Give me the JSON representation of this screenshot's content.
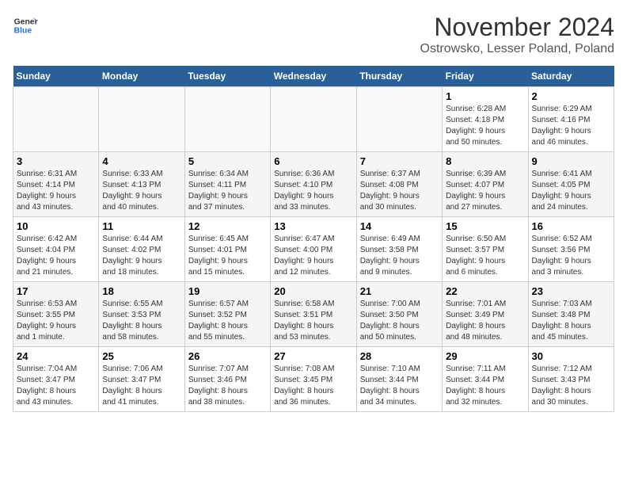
{
  "header": {
    "logo_line1": "General",
    "logo_line2": "Blue",
    "month_title": "November 2024",
    "subtitle": "Ostrowsko, Lesser Poland, Poland"
  },
  "weekdays": [
    "Sunday",
    "Monday",
    "Tuesday",
    "Wednesday",
    "Thursday",
    "Friday",
    "Saturday"
  ],
  "weeks": [
    [
      {
        "day": "",
        "info": ""
      },
      {
        "day": "",
        "info": ""
      },
      {
        "day": "",
        "info": ""
      },
      {
        "day": "",
        "info": ""
      },
      {
        "day": "",
        "info": ""
      },
      {
        "day": "1",
        "info": "Sunrise: 6:28 AM\nSunset: 4:18 PM\nDaylight: 9 hours\nand 50 minutes."
      },
      {
        "day": "2",
        "info": "Sunrise: 6:29 AM\nSunset: 4:16 PM\nDaylight: 9 hours\nand 46 minutes."
      }
    ],
    [
      {
        "day": "3",
        "info": "Sunrise: 6:31 AM\nSunset: 4:14 PM\nDaylight: 9 hours\nand 43 minutes."
      },
      {
        "day": "4",
        "info": "Sunrise: 6:33 AM\nSunset: 4:13 PM\nDaylight: 9 hours\nand 40 minutes."
      },
      {
        "day": "5",
        "info": "Sunrise: 6:34 AM\nSunset: 4:11 PM\nDaylight: 9 hours\nand 37 minutes."
      },
      {
        "day": "6",
        "info": "Sunrise: 6:36 AM\nSunset: 4:10 PM\nDaylight: 9 hours\nand 33 minutes."
      },
      {
        "day": "7",
        "info": "Sunrise: 6:37 AM\nSunset: 4:08 PM\nDaylight: 9 hours\nand 30 minutes."
      },
      {
        "day": "8",
        "info": "Sunrise: 6:39 AM\nSunset: 4:07 PM\nDaylight: 9 hours\nand 27 minutes."
      },
      {
        "day": "9",
        "info": "Sunrise: 6:41 AM\nSunset: 4:05 PM\nDaylight: 9 hours\nand 24 minutes."
      }
    ],
    [
      {
        "day": "10",
        "info": "Sunrise: 6:42 AM\nSunset: 4:04 PM\nDaylight: 9 hours\nand 21 minutes."
      },
      {
        "day": "11",
        "info": "Sunrise: 6:44 AM\nSunset: 4:02 PM\nDaylight: 9 hours\nand 18 minutes."
      },
      {
        "day": "12",
        "info": "Sunrise: 6:45 AM\nSunset: 4:01 PM\nDaylight: 9 hours\nand 15 minutes."
      },
      {
        "day": "13",
        "info": "Sunrise: 6:47 AM\nSunset: 4:00 PM\nDaylight: 9 hours\nand 12 minutes."
      },
      {
        "day": "14",
        "info": "Sunrise: 6:49 AM\nSunset: 3:58 PM\nDaylight: 9 hours\nand 9 minutes."
      },
      {
        "day": "15",
        "info": "Sunrise: 6:50 AM\nSunset: 3:57 PM\nDaylight: 9 hours\nand 6 minutes."
      },
      {
        "day": "16",
        "info": "Sunrise: 6:52 AM\nSunset: 3:56 PM\nDaylight: 9 hours\nand 3 minutes."
      }
    ],
    [
      {
        "day": "17",
        "info": "Sunrise: 6:53 AM\nSunset: 3:55 PM\nDaylight: 9 hours\nand 1 minute."
      },
      {
        "day": "18",
        "info": "Sunrise: 6:55 AM\nSunset: 3:53 PM\nDaylight: 8 hours\nand 58 minutes."
      },
      {
        "day": "19",
        "info": "Sunrise: 6:57 AM\nSunset: 3:52 PM\nDaylight: 8 hours\nand 55 minutes."
      },
      {
        "day": "20",
        "info": "Sunrise: 6:58 AM\nSunset: 3:51 PM\nDaylight: 8 hours\nand 53 minutes."
      },
      {
        "day": "21",
        "info": "Sunrise: 7:00 AM\nSunset: 3:50 PM\nDaylight: 8 hours\nand 50 minutes."
      },
      {
        "day": "22",
        "info": "Sunrise: 7:01 AM\nSunset: 3:49 PM\nDaylight: 8 hours\nand 48 minutes."
      },
      {
        "day": "23",
        "info": "Sunrise: 7:03 AM\nSunset: 3:48 PM\nDaylight: 8 hours\nand 45 minutes."
      }
    ],
    [
      {
        "day": "24",
        "info": "Sunrise: 7:04 AM\nSunset: 3:47 PM\nDaylight: 8 hours\nand 43 minutes."
      },
      {
        "day": "25",
        "info": "Sunrise: 7:06 AM\nSunset: 3:47 PM\nDaylight: 8 hours\nand 41 minutes."
      },
      {
        "day": "26",
        "info": "Sunrise: 7:07 AM\nSunset: 3:46 PM\nDaylight: 8 hours\nand 38 minutes."
      },
      {
        "day": "27",
        "info": "Sunrise: 7:08 AM\nSunset: 3:45 PM\nDaylight: 8 hours\nand 36 minutes."
      },
      {
        "day": "28",
        "info": "Sunrise: 7:10 AM\nSunset: 3:44 PM\nDaylight: 8 hours\nand 34 minutes."
      },
      {
        "day": "29",
        "info": "Sunrise: 7:11 AM\nSunset: 3:44 PM\nDaylight: 8 hours\nand 32 minutes."
      },
      {
        "day": "30",
        "info": "Sunrise: 7:12 AM\nSunset: 3:43 PM\nDaylight: 8 hours\nand 30 minutes."
      }
    ]
  ]
}
